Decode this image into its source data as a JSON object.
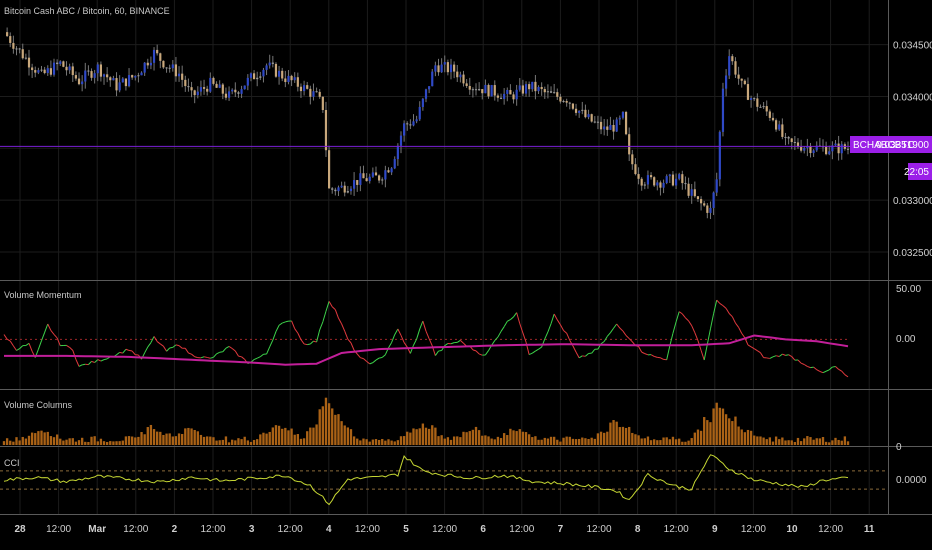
{
  "title": "Bitcoin Cash ABC / Bitcoin, 60, BINANCE",
  "colors": {
    "background": "#000000",
    "grid": "#1c1c1c",
    "separator": "#5a5a5a",
    "candle_up": "#2f49c7",
    "candle_down": "#c9a87c",
    "candle_doji": "#9a9a9a",
    "price_line": "#7a1fd6",
    "price_tag": "#9b1fe8",
    "momentum_up": "#3cd24a",
    "momentum_down": "#e0393d",
    "momentum_avg": "#c21f9a",
    "volume": "#c8731a",
    "cci": "#c6d733",
    "dotted": "#8a6a3a"
  },
  "price_tag": {
    "symbol": "BCHABCBTC",
    "price": "0.03351900",
    "countdown": "22:05"
  },
  "price_axis": [
    "0.03450000",
    "0.03400000",
    "0.03350000",
    "0.03300000",
    "0.03250000"
  ],
  "price_axis_values": [
    0.0345,
    0.034,
    0.0335,
    0.033,
    0.0325
  ],
  "current_price": 0.033519,
  "price_range": [
    0.03223,
    0.03493
  ],
  "panels": {
    "momentum": {
      "label": "Volume Momentum",
      "ticks": [
        "50.00",
        "0.00"
      ],
      "tick_values": [
        50,
        0
      ]
    },
    "volume": {
      "label": "Volume Columns",
      "ticks": [
        "0"
      ]
    },
    "cci": {
      "label": "CCI",
      "ticks": [
        "0.0000"
      ]
    }
  },
  "time_axis": [
    "28",
    "12:00",
    "Mar",
    "12:00",
    "2",
    "12:00",
    "3",
    "12:00",
    "4",
    "12:00",
    "5",
    "12:00",
    "6",
    "12:00",
    "7",
    "12:00",
    "8",
    "12:00",
    "9",
    "12:00",
    "10",
    "12:00",
    "11"
  ],
  "chart_data": {
    "type": "candlestick",
    "symbol": "BCHABCBTC",
    "interval": "60",
    "exchange": "BINANCE",
    "close_points": [
      [
        0,
        0.03462
      ],
      [
        6,
        0.0344
      ],
      [
        12,
        0.0342
      ],
      [
        18,
        0.03432
      ],
      [
        24,
        0.03415
      ],
      [
        30,
        0.03428
      ],
      [
        36,
        0.0341
      ],
      [
        42,
        0.0342
      ],
      [
        48,
        0.03442
      ],
      [
        52,
        0.0343
      ],
      [
        56,
        0.03422
      ],
      [
        60,
        0.034
      ],
      [
        66,
        0.03412
      ],
      [
        72,
        0.034
      ],
      [
        78,
        0.03415
      ],
      [
        84,
        0.0343
      ],
      [
        90,
        0.03418
      ],
      [
        96,
        0.03408
      ],
      [
        100,
        0.034
      ],
      [
        102,
        0.0339
      ],
      [
        104,
        0.0331
      ],
      [
        108,
        0.03312
      ],
      [
        114,
        0.0332
      ],
      [
        120,
        0.03322
      ],
      [
        124,
        0.03335
      ],
      [
        128,
        0.03372
      ],
      [
        132,
        0.03378
      ],
      [
        134,
        0.03395
      ],
      [
        138,
        0.0343
      ],
      [
        144,
        0.03425
      ],
      [
        150,
        0.0341
      ],
      [
        156,
        0.03405
      ],
      [
        162,
        0.034
      ],
      [
        168,
        0.0341
      ],
      [
        174,
        0.03402
      ],
      [
        180,
        0.03398
      ],
      [
        186,
        0.0338
      ],
      [
        192,
        0.03368
      ],
      [
        196,
        0.03372
      ],
      [
        198,
        0.0338
      ],
      [
        200,
        0.0334
      ],
      [
        204,
        0.0332
      ],
      [
        210,
        0.03318
      ],
      [
        216,
        0.0332
      ],
      [
        222,
        0.03298
      ],
      [
        226,
        0.0329
      ],
      [
        228,
        0.0332
      ],
      [
        230,
        0.0341
      ],
      [
        232,
        0.0344
      ],
      [
        236,
        0.0341
      ],
      [
        240,
        0.03395
      ],
      [
        246,
        0.0338
      ],
      [
        250,
        0.03355
      ],
      [
        256,
        0.03352
      ],
      [
        262,
        0.0335
      ],
      [
        270,
        0.0335
      ]
    ],
    "momentum_points": [
      [
        0,
        5
      ],
      [
        4,
        -10
      ],
      [
        8,
        -5
      ],
      [
        10,
        -20
      ],
      [
        14,
        15
      ],
      [
        18,
        -5
      ],
      [
        22,
        -10
      ],
      [
        24,
        -28
      ],
      [
        30,
        -22
      ],
      [
        34,
        -18
      ],
      [
        40,
        -10
      ],
      [
        44,
        -20
      ],
      [
        48,
        2
      ],
      [
        52,
        -12
      ],
      [
        56,
        -5
      ],
      [
        60,
        -16
      ],
      [
        66,
        -20
      ],
      [
        72,
        -8
      ],
      [
        78,
        -24
      ],
      [
        84,
        -15
      ],
      [
        88,
        16
      ],
      [
        92,
        18
      ],
      [
        96,
        -5
      ],
      [
        100,
        -2
      ],
      [
        104,
        40
      ],
      [
        106,
        30
      ],
      [
        110,
        0
      ],
      [
        114,
        -20
      ],
      [
        118,
        -25
      ],
      [
        122,
        -15
      ],
      [
        126,
        10
      ],
      [
        130,
        -15
      ],
      [
        134,
        18
      ],
      [
        138,
        -16
      ],
      [
        142,
        -5
      ],
      [
        146,
        -2
      ],
      [
        150,
        -10
      ],
      [
        154,
        -17
      ],
      [
        160,
        14
      ],
      [
        164,
        28
      ],
      [
        168,
        -15
      ],
      [
        172,
        -7
      ],
      [
        176,
        25
      ],
      [
        180,
        5
      ],
      [
        184,
        -20
      ],
      [
        190,
        -10
      ],
      [
        196,
        15
      ],
      [
        200,
        2
      ],
      [
        204,
        -12
      ],
      [
        208,
        -18
      ],
      [
        212,
        -20
      ],
      [
        216,
        30
      ],
      [
        220,
        15
      ],
      [
        224,
        -20
      ],
      [
        228,
        40
      ],
      [
        232,
        28
      ],
      [
        238,
        -5
      ],
      [
        244,
        -20
      ],
      [
        250,
        -15
      ],
      [
        256,
        -25
      ],
      [
        262,
        -35
      ],
      [
        266,
        -28
      ],
      [
        270,
        -40
      ]
    ],
    "momentum_avg_points": [
      [
        0,
        -17
      ],
      [
        20,
        -17
      ],
      [
        40,
        -18
      ],
      [
        60,
        -21
      ],
      [
        80,
        -24
      ],
      [
        90,
        -26
      ],
      [
        100,
        -25
      ],
      [
        108,
        -14
      ],
      [
        120,
        -10
      ],
      [
        140,
        -8
      ],
      [
        160,
        -6
      ],
      [
        180,
        -5
      ],
      [
        200,
        -6
      ],
      [
        220,
        -6
      ],
      [
        232,
        -4
      ],
      [
        240,
        4
      ],
      [
        250,
        0
      ],
      [
        260,
        -2
      ],
      [
        270,
        -7
      ]
    ],
    "volume_peaks": [
      [
        104,
        1.0
      ],
      [
        134,
        0.55
      ],
      [
        196,
        0.58
      ],
      [
        228,
        0.88
      ],
      [
        234,
        0.55
      ],
      [
        12,
        0.4
      ],
      [
        48,
        0.45
      ],
      [
        60,
        0.42
      ],
      [
        88,
        0.52
      ],
      [
        150,
        0.38
      ],
      [
        164,
        0.42
      ],
      [
        200,
        0.3
      ]
    ],
    "cci_points": [
      [
        0,
        0
      ],
      [
        10,
        0.15
      ],
      [
        20,
        -0.1
      ],
      [
        30,
        0.2
      ],
      [
        40,
        0.05
      ],
      [
        50,
        -0.1
      ],
      [
        60,
        0.15
      ],
      [
        70,
        -0.05
      ],
      [
        80,
        0.1
      ],
      [
        90,
        0.25
      ],
      [
        98,
        -0.3
      ],
      [
        104,
        -1.3
      ],
      [
        110,
        0.05
      ],
      [
        120,
        0.15
      ],
      [
        126,
        0.3
      ],
      [
        128,
        1.3
      ],
      [
        134,
        0.5
      ],
      [
        140,
        0.3
      ],
      [
        150,
        0.1
      ],
      [
        160,
        0.25
      ],
      [
        170,
        -0.1
      ],
      [
        180,
        -0.2
      ],
      [
        190,
        -0.4
      ],
      [
        196,
        -0.6
      ],
      [
        200,
        -1.1
      ],
      [
        206,
        0.3
      ],
      [
        214,
        -0.3
      ],
      [
        220,
        -0.5
      ],
      [
        226,
        1.4
      ],
      [
        232,
        0.6
      ],
      [
        240,
        0.0
      ],
      [
        248,
        -0.2
      ],
      [
        256,
        -0.4
      ],
      [
        262,
        0.0
      ],
      [
        270,
        0.1
      ]
    ]
  }
}
